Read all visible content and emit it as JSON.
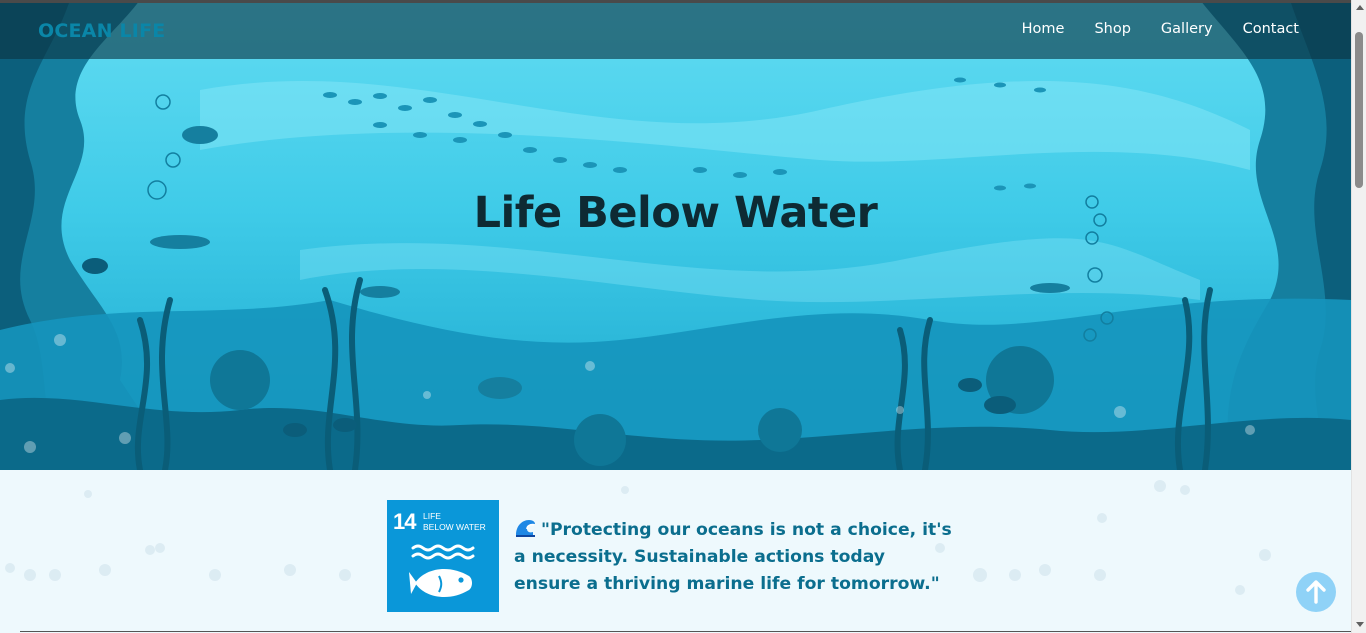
{
  "brand": "OCEAN LIFE",
  "nav": {
    "items": [
      {
        "label": "Home"
      },
      {
        "label": "Shop"
      },
      {
        "label": "Gallery"
      },
      {
        "label": "Contact"
      }
    ]
  },
  "hero": {
    "title": "Life Below Water",
    "background": "underwater-coral-reef-illustration"
  },
  "sdg_badge": {
    "number": "14",
    "line1": "LIFE",
    "line2": "BELOW WATER",
    "icon": "fish-waves-icon",
    "color": "#0a97d9"
  },
  "quote": {
    "icon": "water-wave-emoji",
    "text": "\"Protecting our oceans is not a choice, it's a necessity. Sustainable actions today ensure a thriving marine life for tomorrow.\""
  },
  "scroll_top": {
    "icon": "arrow-up-icon"
  },
  "colors": {
    "accent": "#0b6e8e",
    "brand": "#0a86a8",
    "navbar": "#0c3442",
    "content_bg": "#eef9fd",
    "hero_light": "#5fd9f0"
  }
}
